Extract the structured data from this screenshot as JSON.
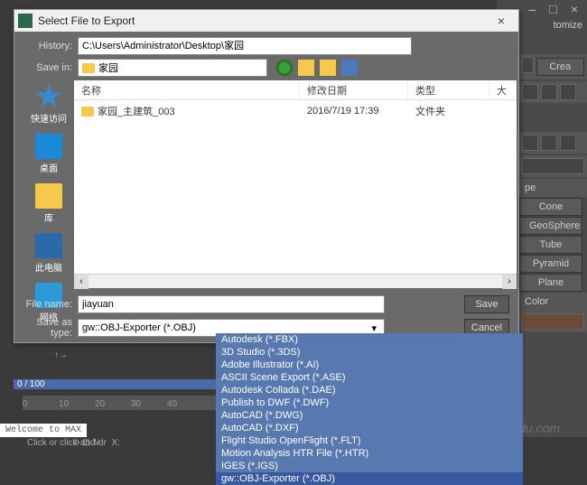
{
  "topbar": {
    "minus": "–",
    "square": "□",
    "close": "×"
  },
  "customize": "tomize",
  "right": {
    "create": "Crea",
    "section_shape": "pe",
    "buttons": [
      "Cone",
      "GeoSphere",
      "Tube",
      "Pyramid",
      "Plane"
    ],
    "color_label": "Color"
  },
  "dialog": {
    "title": "Select File to Export",
    "history_label": "History:",
    "history_value": "C:\\Users\\Administrator\\Desktop\\家园",
    "savein_label": "Save in:",
    "savein_value": "家园",
    "sidebar": [
      {
        "label": "快速访问",
        "icon": "ico-star"
      },
      {
        "label": "桌面",
        "icon": "ico-desktop"
      },
      {
        "label": "库",
        "icon": "ico-lib"
      },
      {
        "label": "此电脑",
        "icon": "ico-pc"
      },
      {
        "label": "网络",
        "icon": "ico-net"
      }
    ],
    "columns": {
      "name": "名称",
      "date": "修改日期",
      "type": "类型",
      "size": "大"
    },
    "rows": [
      {
        "name": "家园_主建筑_003",
        "date": "2016/7/19 17:39",
        "type": "文件夹"
      }
    ],
    "filename_label": "File name:",
    "filename_value": "jiayuan",
    "saveastype_label": "Save as type:",
    "saveastype_value": "gw::OBJ-Exporter (*.OBJ)",
    "save_btn": "Save",
    "cancel_btn": "Cancel",
    "type_options": [
      "Autodesk (*.FBX)",
      "3D Studio (*.3DS)",
      "Adobe Illustrator (*.AI)",
      "ASCII Scene Export (*.ASE)",
      "Autodesk Collada (*.DAE)",
      "Publish to DWF (*.DWF)",
      "AutoCAD (*.DWG)",
      "AutoCAD (*.DXF)",
      "Flight Studio OpenFlight (*.FLT)",
      "Motion Analysis HTR File (*.HTR)",
      "IGES (*.IGS)",
      "gw::OBJ-Exporter (*.OBJ)"
    ],
    "selected_index": 11
  },
  "timeline": {
    "pos": "0 / 100",
    "ticks": [
      "0",
      "10",
      "20",
      "30",
      "40"
    ]
  },
  "welcome": "Welcome to MAX",
  "statusbar": "Click or click-and-dr",
  "vp_x": "X:",
  "watermark": "jingyan.baidu.com"
}
